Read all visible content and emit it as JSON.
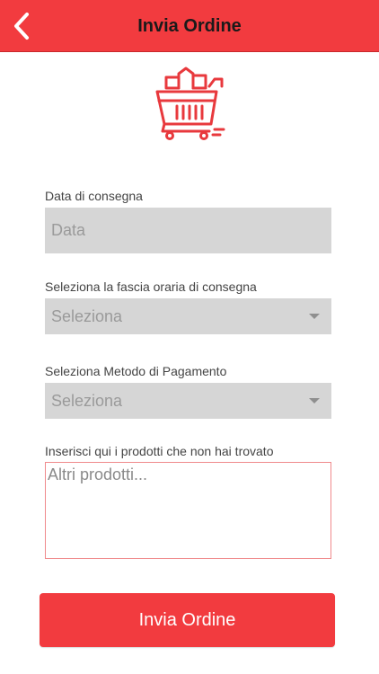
{
  "header": {
    "title": "Invia Ordine",
    "background_color": "#f23b3f",
    "back_icon": "chevron-left-icon"
  },
  "logo": {
    "icon": "shopping-cart-icon",
    "color": "#e8393d"
  },
  "form": {
    "delivery_date": {
      "label": "Data di consegna",
      "placeholder": "Data",
      "value": ""
    },
    "time_slot": {
      "label": "Seleziona la fascia oraria di consegna",
      "selected": "Seleziona"
    },
    "payment_method": {
      "label": "Seleziona Metodo di Pagamento",
      "selected": "Seleziona"
    },
    "extra_products": {
      "label": "Inserisci qui i prodotti che non hai trovato",
      "placeholder": "Altri prodotti...",
      "value": ""
    }
  },
  "submit": {
    "label": "Invia Ordine",
    "background_color": "#f23b3f"
  }
}
